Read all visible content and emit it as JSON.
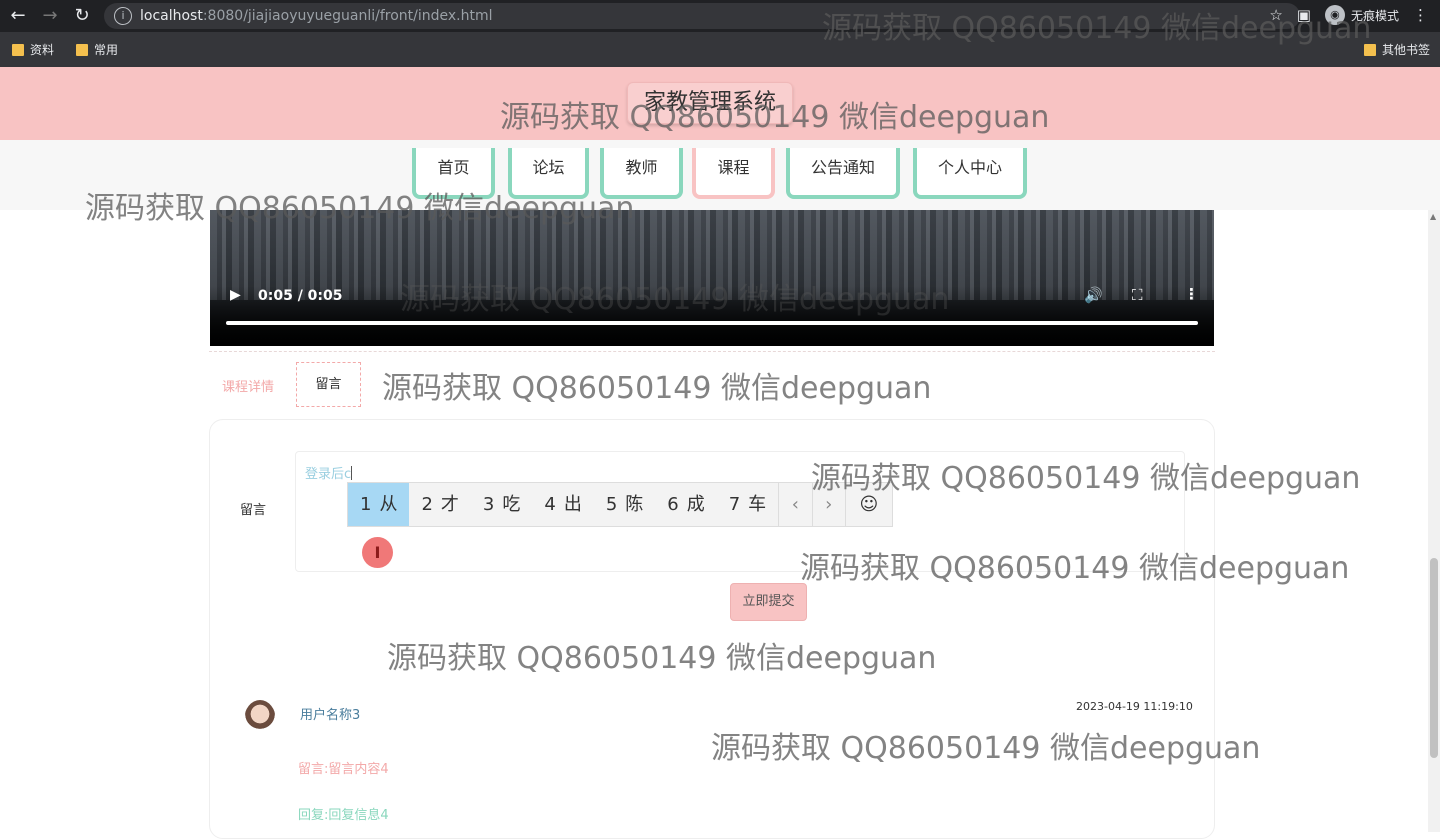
{
  "browser": {
    "url_host": "localhost",
    "url_rest": ":8080/jiajiaoyuyueguanli/front/index.html",
    "incognito_label": "无痕模式",
    "bookmarks": [
      "资料",
      "常用"
    ],
    "other_bookmarks": "其他书签"
  },
  "site": {
    "title": "家教管理系统",
    "nav": [
      "首页",
      "论坛",
      "教师",
      "课程",
      "公告通知",
      "个人中心"
    ],
    "active_nav": "课程"
  },
  "video": {
    "time": "0:05 / 0:05",
    "progress": 1.0
  },
  "tabs": {
    "detail": "课程详情",
    "message": "留言"
  },
  "form": {
    "label": "留言",
    "input_text": "登录后c",
    "submit": "立即提交"
  },
  "ime": {
    "candidates": [
      {
        "num": "1",
        "text": "从"
      },
      {
        "num": "2",
        "text": "才"
      },
      {
        "num": "3",
        "text": "吃"
      },
      {
        "num": "4",
        "text": "出"
      },
      {
        "num": "5",
        "text": "陈"
      },
      {
        "num": "6",
        "text": "成"
      },
      {
        "num": "7",
        "text": "车"
      }
    ],
    "prev": "‹",
    "next": "›",
    "emoji": "☺"
  },
  "comment": {
    "username": "用户名称3",
    "time": "2023-04-19 11:19:10",
    "content": "留言:留言内容4",
    "reply": "回复:回复信息4"
  },
  "watermark": "源码获取 QQ86050149 微信deepguan",
  "colors": {
    "brand_pink": "#f8c3c3",
    "accent_green": "#8ad7bd"
  }
}
